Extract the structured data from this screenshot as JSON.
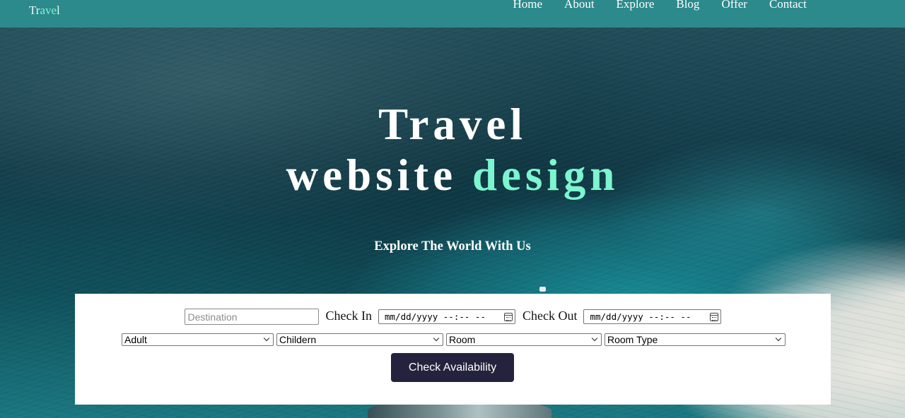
{
  "navbar": {
    "logo_prefix": "Tr",
    "logo_accent": "ave",
    "logo_suffix": "l",
    "links": [
      "Home",
      "About",
      "Explore",
      "Blog",
      "Offer",
      "Contact"
    ],
    "bg_color": "#2c8a8c",
    "accent_color": "#7df5cf"
  },
  "hero": {
    "title_line1": "Travel",
    "title_line2_plain": "website ",
    "title_line2_accent": "design",
    "subtitle": "Explore The World With Us"
  },
  "booking": {
    "destination_placeholder": "Destination",
    "destination_value": "",
    "check_in_label": "Check In",
    "check_in_value": "mm/dd/yyyy --:-- --",
    "check_out_label": "Check Out",
    "check_out_value": "mm/dd/yyyy --:-- --",
    "selects": {
      "adult": "Adult",
      "children": "Childern",
      "room": "Room",
      "room_type": "Room Type"
    },
    "submit_label": "Check Availability",
    "button_color": "#24233d"
  }
}
